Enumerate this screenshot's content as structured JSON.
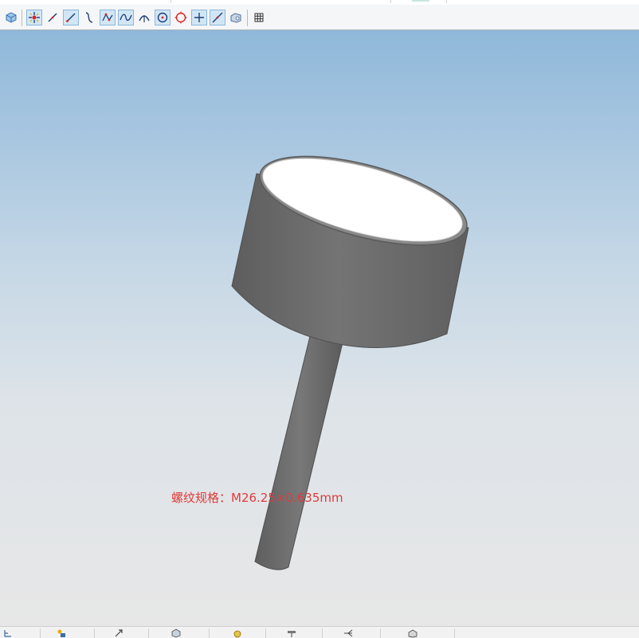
{
  "annotation": {
    "thread_spec": "螺纹规格：M26.25×0.635mm",
    "color": "#e03b3b"
  },
  "toolbar": {
    "items": [
      {
        "icon": "3d-box-icon",
        "active": false
      },
      {
        "icon": "point-snap-icon",
        "active": true
      },
      {
        "icon": "line-icon",
        "active": false
      },
      {
        "icon": "line-segment-icon",
        "active": true
      },
      {
        "icon": "curve-icon",
        "active": false
      },
      {
        "icon": "polyline-icon",
        "active": true
      },
      {
        "icon": "spline-icon",
        "active": true
      },
      {
        "icon": "arc-icon",
        "active": false
      },
      {
        "icon": "circle-center-icon",
        "active": true
      },
      {
        "icon": "circle-icon",
        "active": false
      },
      {
        "icon": "crosshair-icon",
        "active": true
      },
      {
        "icon": "tangent-line-icon",
        "active": true
      },
      {
        "icon": "solid-view-icon",
        "active": false
      },
      {
        "icon": "grid-icon",
        "active": false
      }
    ]
  },
  "viewport": {
    "background_top": "#8fb8da",
    "background_bottom": "#e7e7e7",
    "model_color": "#6b6b6b",
    "cap_color": "#ffffff"
  },
  "statusbar": {
    "icons": [
      "tree-icon",
      "assembly-icon",
      "sketch-icon",
      "part-icon",
      "feature-icon",
      "tool-icon",
      "branch-icon",
      "view-icon"
    ]
  }
}
